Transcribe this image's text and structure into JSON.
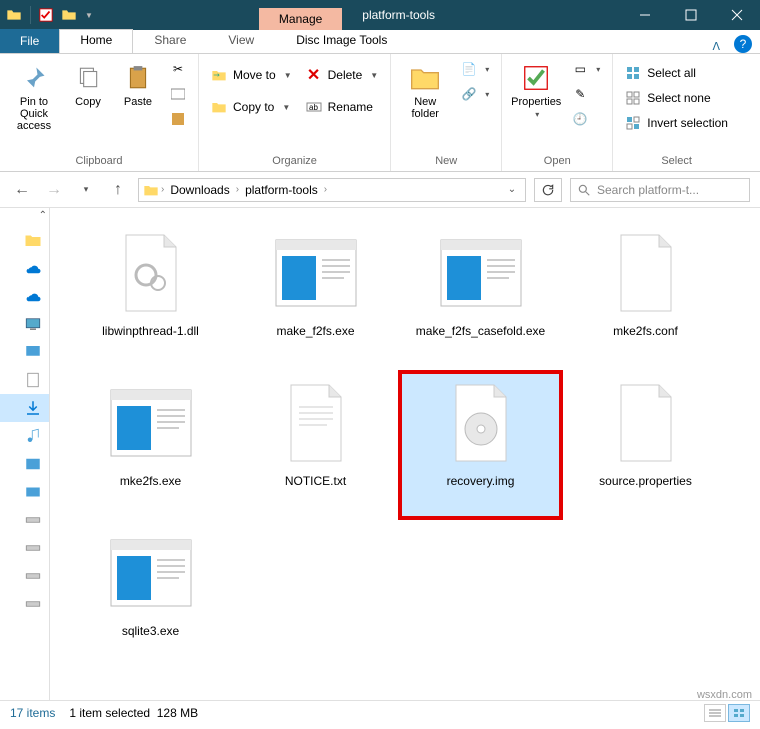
{
  "window": {
    "manage_tab": "Manage",
    "title": "platform-tools"
  },
  "tabs": {
    "file": "File",
    "home": "Home",
    "share": "Share",
    "view": "View",
    "context": "Disc Image Tools"
  },
  "ribbon": {
    "clipboard": {
      "label": "Clipboard",
      "pin": "Pin to Quick access",
      "copy": "Copy",
      "paste": "Paste"
    },
    "organize": {
      "label": "Organize",
      "move_to": "Move to",
      "copy_to": "Copy to",
      "delete": "Delete",
      "rename": "Rename"
    },
    "new": {
      "label": "New",
      "new_folder": "New folder"
    },
    "open": {
      "label": "Open",
      "properties": "Properties"
    },
    "select": {
      "label": "Select",
      "select_all": "Select all",
      "select_none": "Select none",
      "invert": "Invert selection"
    }
  },
  "address": {
    "crumbs": [
      "Downloads",
      "platform-tools"
    ]
  },
  "search": {
    "placeholder": "Search platform-t..."
  },
  "files": [
    {
      "name": "libwinpthread-1.dll",
      "type": "dll"
    },
    {
      "name": "make_f2fs.exe",
      "type": "exe"
    },
    {
      "name": "make_f2fs_casefold.exe",
      "type": "exe"
    },
    {
      "name": "mke2fs.conf",
      "type": "generic"
    },
    {
      "name": "mke2fs.exe",
      "type": "exe"
    },
    {
      "name": "NOTICE.txt",
      "type": "txt"
    },
    {
      "name": "recovery.img",
      "type": "img",
      "selected": true,
      "highlighted": true
    },
    {
      "name": "source.properties",
      "type": "generic"
    },
    {
      "name": "sqlite3.exe",
      "type": "exe"
    }
  ],
  "status": {
    "count": "17 items",
    "selection": "1 item selected",
    "size": "128 MB"
  },
  "watermark": "wsxdn.com"
}
